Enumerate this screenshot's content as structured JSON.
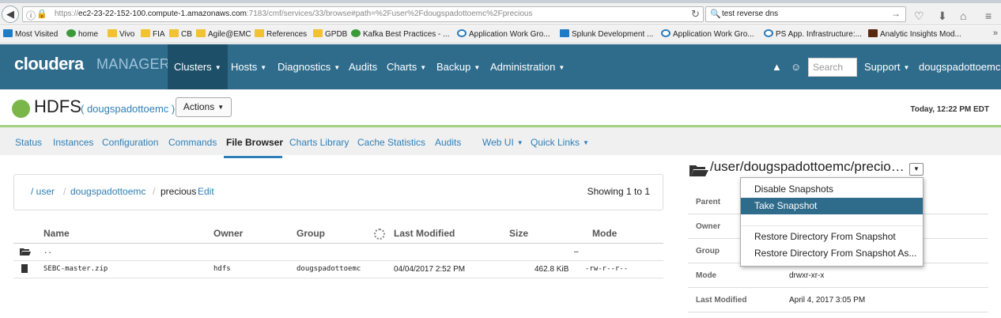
{
  "browser": {
    "url_prefix": "https://",
    "url_host": "ec2-23-22-152-100.compute-1.amazonaws.com",
    "url_rest": ":7183/cmf/services/33/browse#path=%2Fuser%2Fdougspadottoemc%2Fprecious",
    "search_value": "test reverse dns",
    "bookmarks": [
      "Most Visited",
      "home",
      "Vivo",
      "FIA",
      "CB",
      "Agile@EMC",
      "References",
      "GPDB",
      "Kafka Best Practices - ...",
      "Application Work Gro...",
      "Splunk Development ...",
      "Application Work Gro...",
      "PS App. Infrastructure:...",
      "Analytic Insights Mod..."
    ],
    "bookmarks_more": "»"
  },
  "header": {
    "logo": "cloudera",
    "logo_sub": "MANAGER",
    "nav": [
      "Clusters",
      "Hosts",
      "Diagnostics",
      "Audits",
      "Charts",
      "Backup",
      "Administration"
    ],
    "search_placeholder": "Search",
    "support": "Support",
    "user": "dougspadottoemc"
  },
  "service": {
    "name": "HDFS",
    "cluster": "( dougspadottoemc )",
    "actions": "Actions",
    "time": "Today, 12:22 PM EDT",
    "tabs": [
      "Status",
      "Instances",
      "Configuration",
      "Commands",
      "File Browser",
      "Charts Library",
      "Cache Statistics",
      "Audits",
      "Web UI",
      "Quick Links"
    ]
  },
  "breadcrumb": {
    "root": "/ user",
    "sep": "/",
    "dir": "dougspadottoemc",
    "current": "precious",
    "edit": "Edit",
    "showing": "Showing 1 to 1"
  },
  "table": {
    "headers": [
      "Name",
      "Owner",
      "Group",
      "Last Modified",
      "Size",
      "Mode"
    ],
    "rows": [
      {
        "name": "..",
        "owner": "",
        "group": "",
        "modified": "",
        "size": "",
        "mode": "–"
      },
      {
        "name": "SEBC-master.zip",
        "owner": "hdfs",
        "group": "dougspadottoemc",
        "modified": "04/04/2017 2:52 PM",
        "size": "462.8 KiB",
        "mode": "-rw-r--r--"
      }
    ]
  },
  "panel": {
    "path": "/user/dougspadottoemc/precio…",
    "props": [
      {
        "key": "Parent",
        "value": ""
      },
      {
        "key": "Owner",
        "value": ""
      },
      {
        "key": "Group",
        "value": ""
      },
      {
        "key": "Mode",
        "value": "drwxr-xr-x"
      },
      {
        "key": "Last Modified",
        "value": "April 4, 2017 3:05 PM"
      }
    ],
    "menu": [
      "Disable Snapshots",
      "Take Snapshot",
      "Restore Directory From Snapshot",
      "Restore Directory From Snapshot As..."
    ]
  }
}
